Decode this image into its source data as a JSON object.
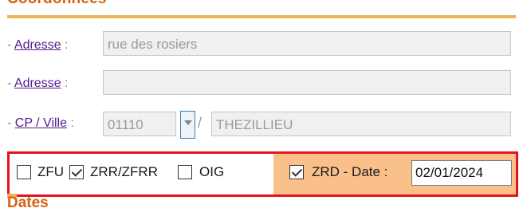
{
  "section": {
    "title": "Coordonnées"
  },
  "address1": {
    "prefix": "- ",
    "label": "Adresse",
    "sep": " :",
    "value": "rue des rosiers"
  },
  "address2": {
    "prefix": "- ",
    "label": "Adresse",
    "sep": " :",
    "value": ""
  },
  "cpville": {
    "prefix": "- ",
    "label": "CP / Ville",
    "sep": " :",
    "cp": "01110",
    "slash": "/",
    "ville": "THEZILLIEU"
  },
  "zones": {
    "zfu": {
      "label": "ZFU",
      "checked": false
    },
    "zrr": {
      "label": "ZRR/ZFRR",
      "checked": true
    },
    "oig": {
      "label": "OIG",
      "checked": false
    },
    "zrd": {
      "label": "ZRD - Date :",
      "checked": true,
      "date": "02/01/2024"
    }
  },
  "next_section": {
    "title": "Dates"
  },
  "colors": {
    "accent": "#d4620f",
    "highlight": "#f9c089",
    "outline": "#e3141b",
    "link": "#551a8b"
  }
}
